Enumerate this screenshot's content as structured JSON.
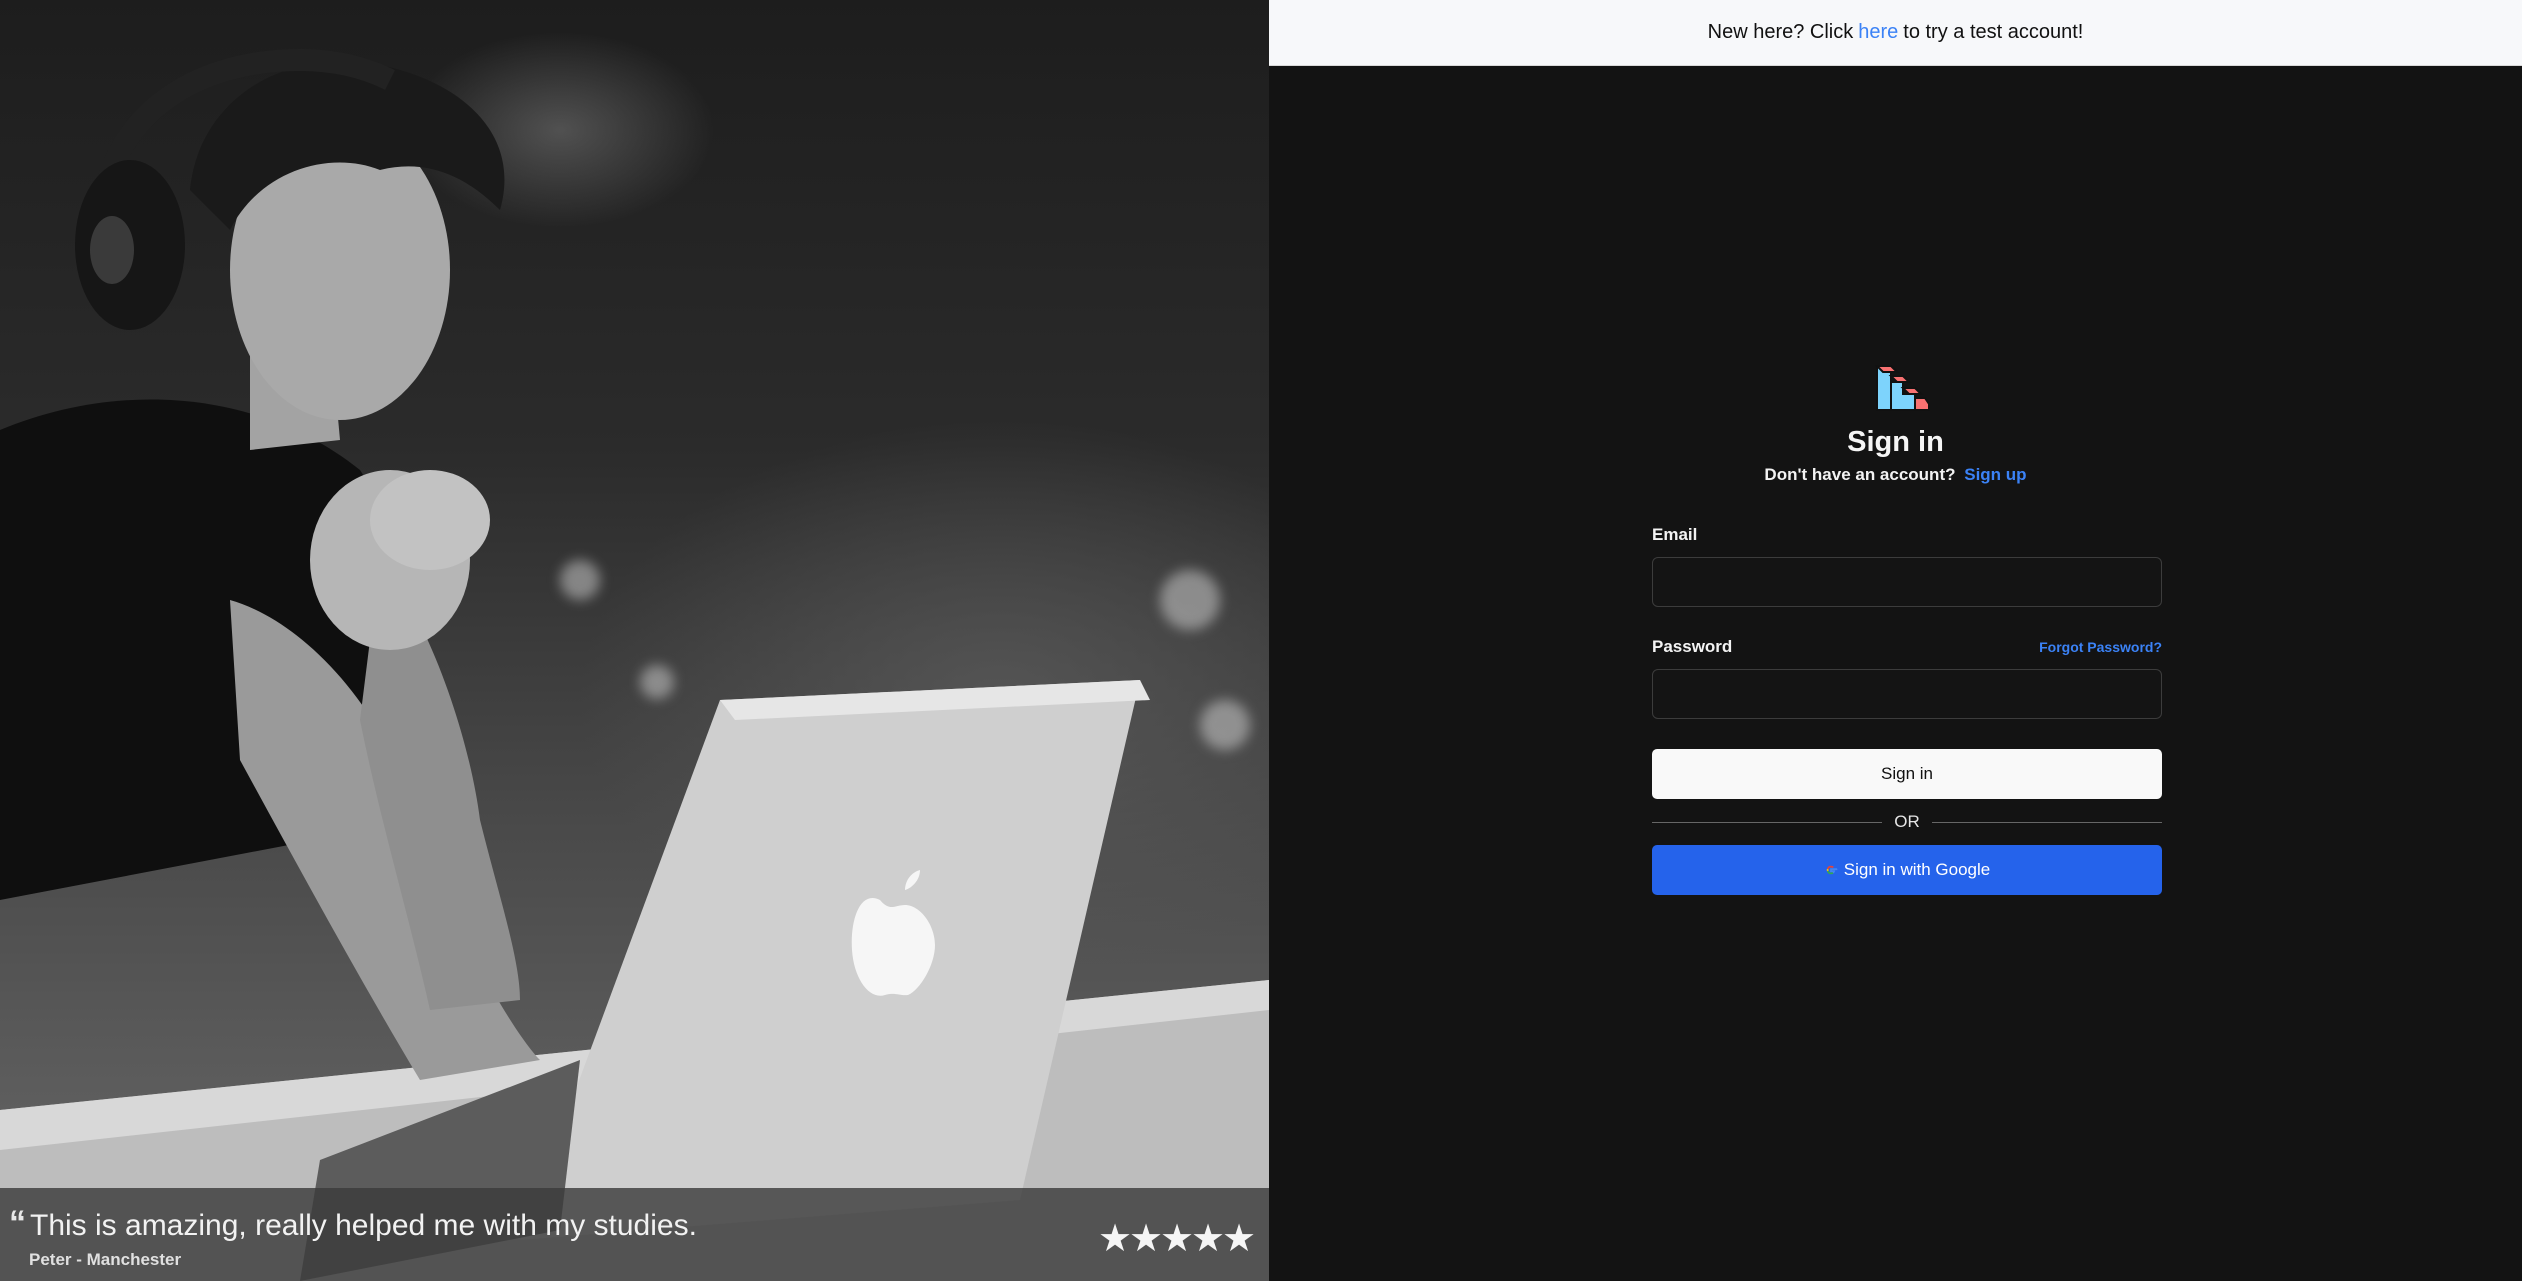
{
  "banner": {
    "prefix": "New here? Click",
    "link": "here",
    "suffix": "to try a test account!"
  },
  "testimonial": {
    "quote_mark": "“",
    "quote": "This is amazing, really helped me with my studies.",
    "author": "Peter - Manchester",
    "rating": 5,
    "star_glyph": "★"
  },
  "auth": {
    "logo_icon": "stairs-icon",
    "title": "Sign in",
    "no_account": "Don't have an account?",
    "signup_link": "Sign up",
    "email_label": "Email",
    "email_value": "",
    "password_label": "Password",
    "password_value": "",
    "forgot_link": "Forgot Password?",
    "signin_button": "Sign in",
    "divider": "OR",
    "google_button": "Sign in with Google",
    "google_icon": "google-icon"
  },
  "colors": {
    "link": "#3b82f6",
    "google_button": "#2563eb",
    "panel_bg": "#131313",
    "banner_bg": "#f7f8fa"
  }
}
